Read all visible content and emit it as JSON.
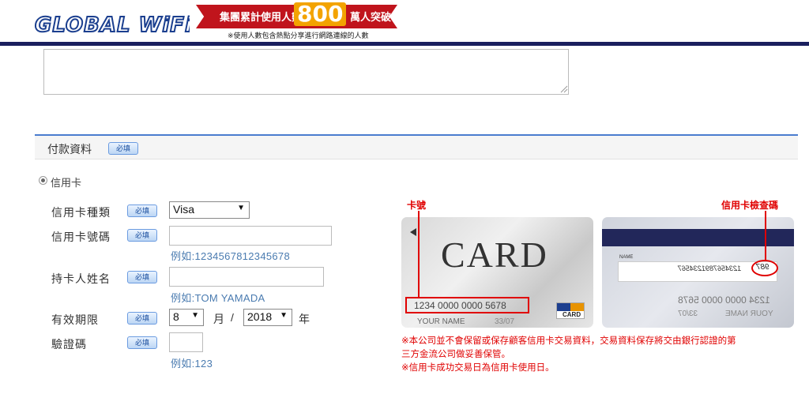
{
  "header": {
    "logo_text": "GLOBAL WiFi",
    "banner": {
      "prefix": "集團累計使用人數",
      "number": "800",
      "suffix": "萬人突破",
      "note": "※使用人數包含熱點分享進行網路連線的人數"
    }
  },
  "section": {
    "title": "付款資料",
    "required_badge": "必填"
  },
  "payment": {
    "method_label": "信用卡",
    "card_type": {
      "label": "信用卡種類",
      "badge": "必填",
      "value": "Visa"
    },
    "card_number": {
      "label": "信用卡號碼",
      "badge": "必填",
      "value": "",
      "hint": "例如:1234567812345678"
    },
    "holder_name": {
      "label": "持卡人姓名",
      "badge": "必填",
      "value": "",
      "hint": "例如:TOM YAMADA"
    },
    "expiry": {
      "label": "有效期限",
      "badge": "必填",
      "month": "8",
      "month_unit": "月",
      "separator": "/",
      "year": "2018",
      "year_unit": "年"
    },
    "cvv": {
      "label": "驗證碼",
      "badge": "必填",
      "value": "",
      "hint": "例如:123"
    }
  },
  "card_image": {
    "number_callout": "卡號",
    "cvv_callout": "信用卡檢查碼",
    "front_word": "CARD",
    "front_number": "1234 0000 0000 5678",
    "front_name": "YOUR NAME",
    "front_exp": "33/07",
    "logo_text": "CARD",
    "back_label": "NAME",
    "back_sig_number": "1234567891234567",
    "back_cvv": "987",
    "back_number": "1234 0000 0000 5678",
    "back_name": "YOUR NAME",
    "back_exp": "33/07"
  },
  "notes": [
    "※本公司並不會保留或保存顧客信用卡交易資料，交易資料保存將交由銀行認證的第",
    "三方金流公司做妥善保管。",
    "※信用卡成功交易日為信用卡使用日。"
  ],
  "colors": {
    "accent": "#4a7ccf",
    "header_bar": "#1a1f5e",
    "warning": "#e00000",
    "hint": "#4a7bb0"
  }
}
